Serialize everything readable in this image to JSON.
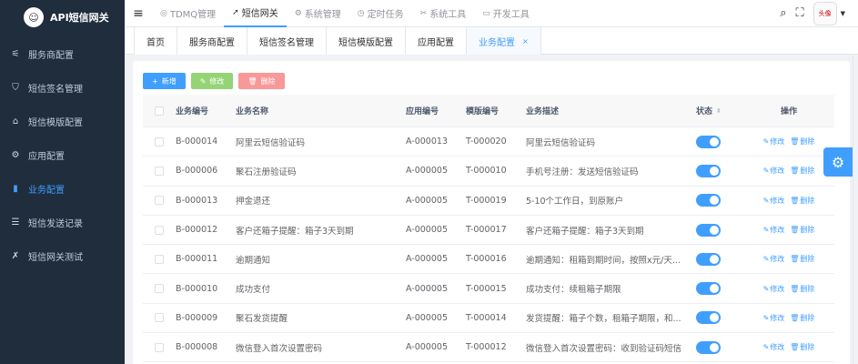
{
  "app": {
    "title": "API短信网关",
    "logo_text": "☺"
  },
  "sidebar": {
    "items": [
      {
        "label": "服务商配置",
        "icon": "sliders-icon",
        "glyph": "⚟",
        "active": false
      },
      {
        "label": "短信签名管理",
        "icon": "shield-check-icon",
        "glyph": "⛉",
        "active": false
      },
      {
        "label": "短信模版配置",
        "icon": "tag-icon",
        "glyph": "⌂",
        "active": false
      },
      {
        "label": "应用配置",
        "icon": "gear-icon",
        "glyph": "⚙",
        "active": false
      },
      {
        "label": "业务配置",
        "icon": "bar-chart-icon",
        "glyph": "▮",
        "active": true
      },
      {
        "label": "短信发送记录",
        "icon": "list-icon",
        "glyph": "☰",
        "active": false
      },
      {
        "label": "短信网关测试",
        "icon": "tools-icon",
        "glyph": "✗",
        "active": false
      }
    ]
  },
  "topbar": {
    "menu": [
      {
        "label": "TDMQ管理",
        "glyph": "◎",
        "active": false
      },
      {
        "label": "短信网关",
        "glyph": "➚",
        "active": true
      },
      {
        "label": "系统管理",
        "glyph": "⚙",
        "active": false
      },
      {
        "label": "定时任务",
        "glyph": "◷",
        "active": false
      },
      {
        "label": "系统工具",
        "glyph": "✂",
        "active": false
      },
      {
        "label": "开发工具",
        "glyph": "▭",
        "active": false
      }
    ],
    "avatar_text": "头像"
  },
  "tags": [
    {
      "label": "首页",
      "active": false
    },
    {
      "label": "服务商配置",
      "active": false
    },
    {
      "label": "短信签名管理",
      "active": false
    },
    {
      "label": "短信模版配置",
      "active": false
    },
    {
      "label": "应用配置",
      "active": false
    },
    {
      "label": "业务配置",
      "active": true
    }
  ],
  "toolbar": {
    "add_label": "新增",
    "edit_label": "修改",
    "delete_label": "删除"
  },
  "table": {
    "headers": {
      "bid": "业务编号",
      "name": "业务名称",
      "aid": "应用编号",
      "tid": "模版编号",
      "desc": "业务描述",
      "status": "状态",
      "ops": "操作"
    },
    "edit_label": "修改",
    "delete_label": "删除",
    "rows": [
      {
        "bid": "B-000014",
        "name": "阿里云短信验证码",
        "aid": "A-000013",
        "tid": "T-000020",
        "desc": "阿里云短信验证码",
        "enabled": true
      },
      {
        "bid": "B-000006",
        "name": "聚石注册验证码",
        "aid": "A-000005",
        "tid": "T-000010",
        "desc": "手机号注册：发送短信验证码",
        "enabled": true
      },
      {
        "bid": "B-000013",
        "name": "押金退还",
        "aid": "A-000005",
        "tid": "T-000019",
        "desc": "5-10个工作日，到原账户",
        "enabled": true
      },
      {
        "bid": "B-000012",
        "name": "客户还箱子提醒：箱子3天到期",
        "aid": "A-000005",
        "tid": "T-000017",
        "desc": "客户还箱子提醒：箱子3天到期",
        "enabled": true
      },
      {
        "bid": "B-000011",
        "name": "逾期通知",
        "aid": "A-000005",
        "tid": "T-000016",
        "desc": "逾期通知：租箱到期时间，按照x元/天...",
        "enabled": true
      },
      {
        "bid": "B-000010",
        "name": "成功支付",
        "aid": "A-000005",
        "tid": "T-000015",
        "desc": "成功支付：续租箱子期限",
        "enabled": true
      },
      {
        "bid": "B-000009",
        "name": "聚石发货提醒",
        "aid": "A-000005",
        "tid": "T-000014",
        "desc": "发货提醒：箱子个数，租箱子期限，和...",
        "enabled": true
      },
      {
        "bid": "B-000008",
        "name": "微信登入首次设置密码",
        "aid": "A-000005",
        "tid": "T-000012",
        "desc": "微信登入首次设置密码：收到验证码短信",
        "enabled": true
      }
    ]
  }
}
